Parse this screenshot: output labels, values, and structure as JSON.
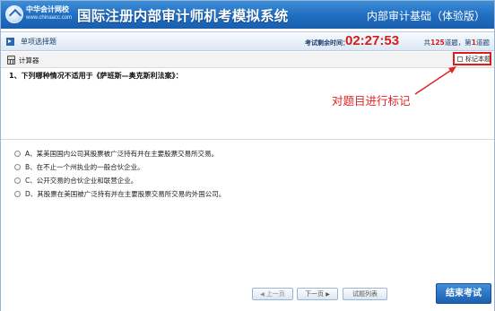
{
  "header": {
    "logo_cn": "中华会计网校",
    "logo_en": "www.chinaacc.com",
    "title": "国际注册内部审计师机考模拟系统",
    "subject": "内部审计基础（体验版）"
  },
  "typebar": {
    "type_label": "单项选择题",
    "timer_label": "考试剩余时间：",
    "timer_value": "02:27:53",
    "progress_pre": "共",
    "total": "125",
    "progress_mid": "道题，第",
    "current": "1",
    "progress_post": "道题"
  },
  "toolbar": {
    "calculator_label": "计算器",
    "mark_label": "标记本题"
  },
  "question": {
    "text": "1、下列哪种情况不适用于《萨班斯—奥克斯利法案》："
  },
  "annotation": {
    "text": "对题目进行标记",
    "color": "#e02424"
  },
  "options": [
    {
      "label": "A、某美国国内公司其股票被广泛持有并在主要股票交易所交易。"
    },
    {
      "label": "B、在不止一个州执业的一般合伙企业。"
    },
    {
      "label": "C、公开交易的合伙企业和联营企业。"
    },
    {
      "label": "D、其股票在美国被广泛持有并在主要股票交易所交易的外国公司。"
    }
  ],
  "footer": {
    "prev_label": "上一页",
    "next_label": "下一页",
    "list_label": "试题列表",
    "end_label": "结束考试"
  },
  "colors": {
    "header_blue": "#1f6cc0",
    "timer_red": "#d21d1d",
    "highlight_red": "#e01b1b"
  }
}
